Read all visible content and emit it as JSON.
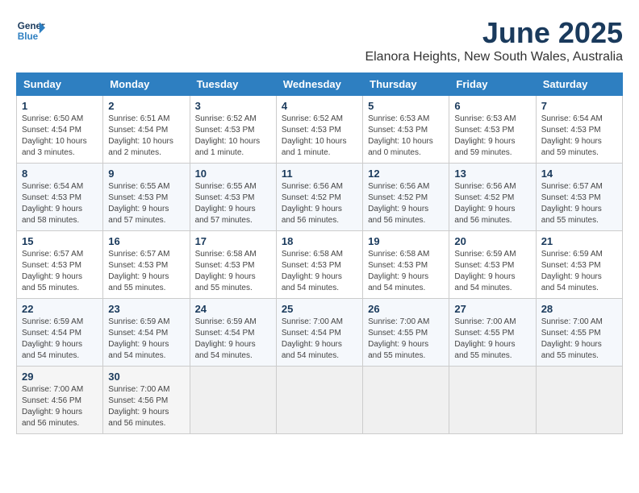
{
  "header": {
    "logo_line1": "General",
    "logo_line2": "Blue",
    "month_year": "June 2025",
    "location": "Elanora Heights, New South Wales, Australia"
  },
  "days_of_week": [
    "Sunday",
    "Monday",
    "Tuesday",
    "Wednesday",
    "Thursday",
    "Friday",
    "Saturday"
  ],
  "weeks": [
    [
      {
        "day": "1",
        "sunrise": "6:50 AM",
        "sunset": "4:54 PM",
        "daylight": "10 hours and 3 minutes."
      },
      {
        "day": "2",
        "sunrise": "6:51 AM",
        "sunset": "4:54 PM",
        "daylight": "10 hours and 2 minutes."
      },
      {
        "day": "3",
        "sunrise": "6:52 AM",
        "sunset": "4:53 PM",
        "daylight": "10 hours and 1 minute."
      },
      {
        "day": "4",
        "sunrise": "6:52 AM",
        "sunset": "4:53 PM",
        "daylight": "10 hours and 1 minute."
      },
      {
        "day": "5",
        "sunrise": "6:53 AM",
        "sunset": "4:53 PM",
        "daylight": "10 hours and 0 minutes."
      },
      {
        "day": "6",
        "sunrise": "6:53 AM",
        "sunset": "4:53 PM",
        "daylight": "9 hours and 59 minutes."
      },
      {
        "day": "7",
        "sunrise": "6:54 AM",
        "sunset": "4:53 PM",
        "daylight": "9 hours and 59 minutes."
      }
    ],
    [
      {
        "day": "8",
        "sunrise": "6:54 AM",
        "sunset": "4:53 PM",
        "daylight": "9 hours and 58 minutes."
      },
      {
        "day": "9",
        "sunrise": "6:55 AM",
        "sunset": "4:53 PM",
        "daylight": "9 hours and 57 minutes."
      },
      {
        "day": "10",
        "sunrise": "6:55 AM",
        "sunset": "4:53 PM",
        "daylight": "9 hours and 57 minutes."
      },
      {
        "day": "11",
        "sunrise": "6:56 AM",
        "sunset": "4:52 PM",
        "daylight": "9 hours and 56 minutes."
      },
      {
        "day": "12",
        "sunrise": "6:56 AM",
        "sunset": "4:52 PM",
        "daylight": "9 hours and 56 minutes."
      },
      {
        "day": "13",
        "sunrise": "6:56 AM",
        "sunset": "4:52 PM",
        "daylight": "9 hours and 56 minutes."
      },
      {
        "day": "14",
        "sunrise": "6:57 AM",
        "sunset": "4:53 PM",
        "daylight": "9 hours and 55 minutes."
      }
    ],
    [
      {
        "day": "15",
        "sunrise": "6:57 AM",
        "sunset": "4:53 PM",
        "daylight": "9 hours and 55 minutes."
      },
      {
        "day": "16",
        "sunrise": "6:57 AM",
        "sunset": "4:53 PM",
        "daylight": "9 hours and 55 minutes."
      },
      {
        "day": "17",
        "sunrise": "6:58 AM",
        "sunset": "4:53 PM",
        "daylight": "9 hours and 55 minutes."
      },
      {
        "day": "18",
        "sunrise": "6:58 AM",
        "sunset": "4:53 PM",
        "daylight": "9 hours and 54 minutes."
      },
      {
        "day": "19",
        "sunrise": "6:58 AM",
        "sunset": "4:53 PM",
        "daylight": "9 hours and 54 minutes."
      },
      {
        "day": "20",
        "sunrise": "6:59 AM",
        "sunset": "4:53 PM",
        "daylight": "9 hours and 54 minutes."
      },
      {
        "day": "21",
        "sunrise": "6:59 AM",
        "sunset": "4:53 PM",
        "daylight": "9 hours and 54 minutes."
      }
    ],
    [
      {
        "day": "22",
        "sunrise": "6:59 AM",
        "sunset": "4:54 PM",
        "daylight": "9 hours and 54 minutes."
      },
      {
        "day": "23",
        "sunrise": "6:59 AM",
        "sunset": "4:54 PM",
        "daylight": "9 hours and 54 minutes."
      },
      {
        "day": "24",
        "sunrise": "6:59 AM",
        "sunset": "4:54 PM",
        "daylight": "9 hours and 54 minutes."
      },
      {
        "day": "25",
        "sunrise": "7:00 AM",
        "sunset": "4:54 PM",
        "daylight": "9 hours and 54 minutes."
      },
      {
        "day": "26",
        "sunrise": "7:00 AM",
        "sunset": "4:55 PM",
        "daylight": "9 hours and 55 minutes."
      },
      {
        "day": "27",
        "sunrise": "7:00 AM",
        "sunset": "4:55 PM",
        "daylight": "9 hours and 55 minutes."
      },
      {
        "day": "28",
        "sunrise": "7:00 AM",
        "sunset": "4:55 PM",
        "daylight": "9 hours and 55 minutes."
      }
    ],
    [
      {
        "day": "29",
        "sunrise": "7:00 AM",
        "sunset": "4:56 PM",
        "daylight": "9 hours and 56 minutes."
      },
      {
        "day": "30",
        "sunrise": "7:00 AM",
        "sunset": "4:56 PM",
        "daylight": "9 hours and 56 minutes."
      },
      null,
      null,
      null,
      null,
      null
    ]
  ]
}
